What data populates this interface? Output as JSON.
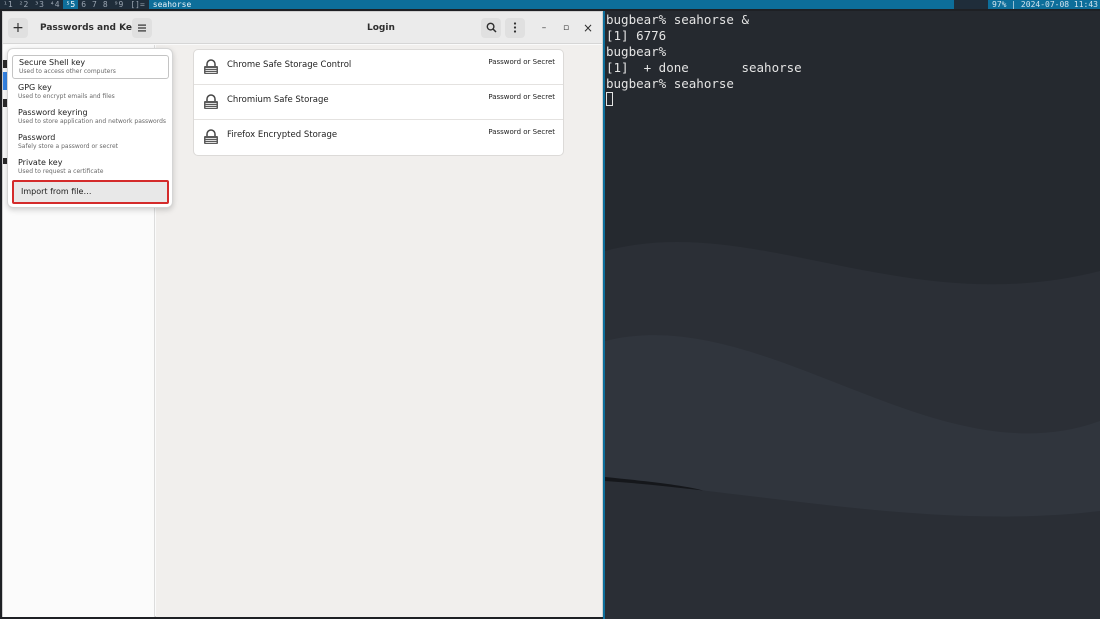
{
  "topbar": {
    "workspaces": [
      "¹1",
      "²2",
      "³3",
      "⁴4",
      "⁵5",
      "6",
      "7",
      "8",
      "⁹9"
    ],
    "active_index": 4,
    "layout": "[]=",
    "window_title": "seahorse",
    "status": "97% | 2024-07-08 11:43"
  },
  "headerbar": {
    "add_icon": "plus-icon",
    "title": "Passwords and Keys",
    "menu_icon": "hamburger-icon",
    "subtitle": "Login",
    "search_icon": "search-icon",
    "more_icon": "vertical-dots-icon",
    "minimize": "–",
    "maximize": "▫",
    "close": "×"
  },
  "popover": {
    "items": [
      {
        "title": "Secure Shell key",
        "subtitle": "Used to access other computers"
      },
      {
        "title": "GPG key",
        "subtitle": "Used to encrypt emails and files"
      },
      {
        "title": "Password keyring",
        "subtitle": "Used to store application and network passwords"
      },
      {
        "title": "Password",
        "subtitle": "Safely store a password or secret"
      },
      {
        "title": "Private key",
        "subtitle": "Used to request a certificate"
      },
      {
        "title": "Import from file…"
      }
    ]
  },
  "items": [
    {
      "name": "Chrome Safe Storage Control",
      "type": "Password or Secret"
    },
    {
      "name": "Chromium Safe Storage",
      "type": "Password or Secret"
    },
    {
      "name": "Firefox Encrypted Storage",
      "type": "Password or Secret"
    }
  ],
  "terminal": {
    "lines": [
      "bugbear% seahorse &",
      "[1] 6776",
      "bugbear%",
      "[1]  + done       seahorse",
      "bugbear% seahorse"
    ]
  },
  "colors": {
    "accent": "#3584e4",
    "highlight_border": "#d42b2b",
    "bar_accent": "#0d6e9a",
    "terminal_bg": "#25292f"
  }
}
